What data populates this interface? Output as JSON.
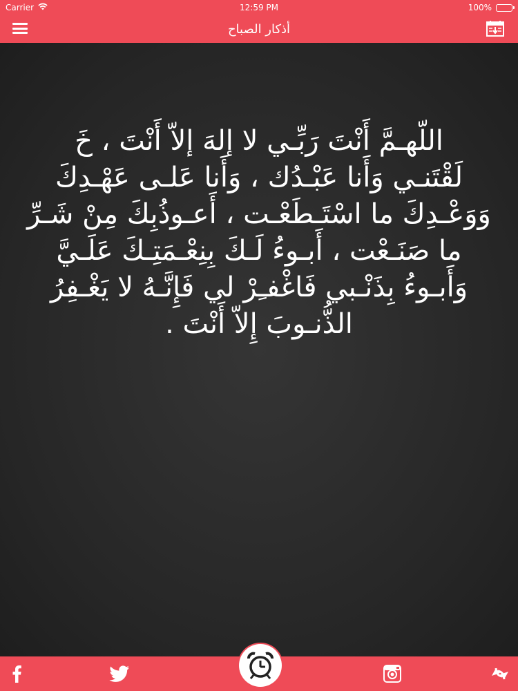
{
  "status_bar": {
    "carrier": "Carrier",
    "time": "12:59 PM",
    "battery": "100%",
    "battery_level": 1.0
  },
  "header": {
    "title": "أذكار الصباح",
    "left_icon": "menu-icon",
    "right_icon": "calendar-icon"
  },
  "content": {
    "prayer_text": "اللّهـمَّ أَنْتَ رَبِّـي لا إلهَ إلاّ أَنْتَ ، خَ\nلَقْتَنـي وَأَنا عَبْـدُك ، وَأَنا عَلـى عَهْـدِكَ وَوَعْـدِكَ ما اسْتَـطَعْـت ، أَعـوذُبِكَ مِنْ شَـرِّ ما صَنَـعْت ، أَبـوءُ لَـكَ بِنِعْـمَتِـكَ عَلَـيَّ وَأَبـوءُ بِذَنْـبي فَاغْفـِرْ لي فَإِنَّـهُ لا يَغْـفِرُ الذُّنـوبَ إِلاّ أَنْتَ ."
  },
  "footer": {
    "icons": [
      "facebook-icon",
      "twitter-icon",
      "alarm-clock-icon",
      "instagram-icon",
      "share-icon"
    ]
  },
  "colors": {
    "accent": "#ef4b57",
    "board": "#2a2a2a",
    "text": "#ffffff"
  }
}
